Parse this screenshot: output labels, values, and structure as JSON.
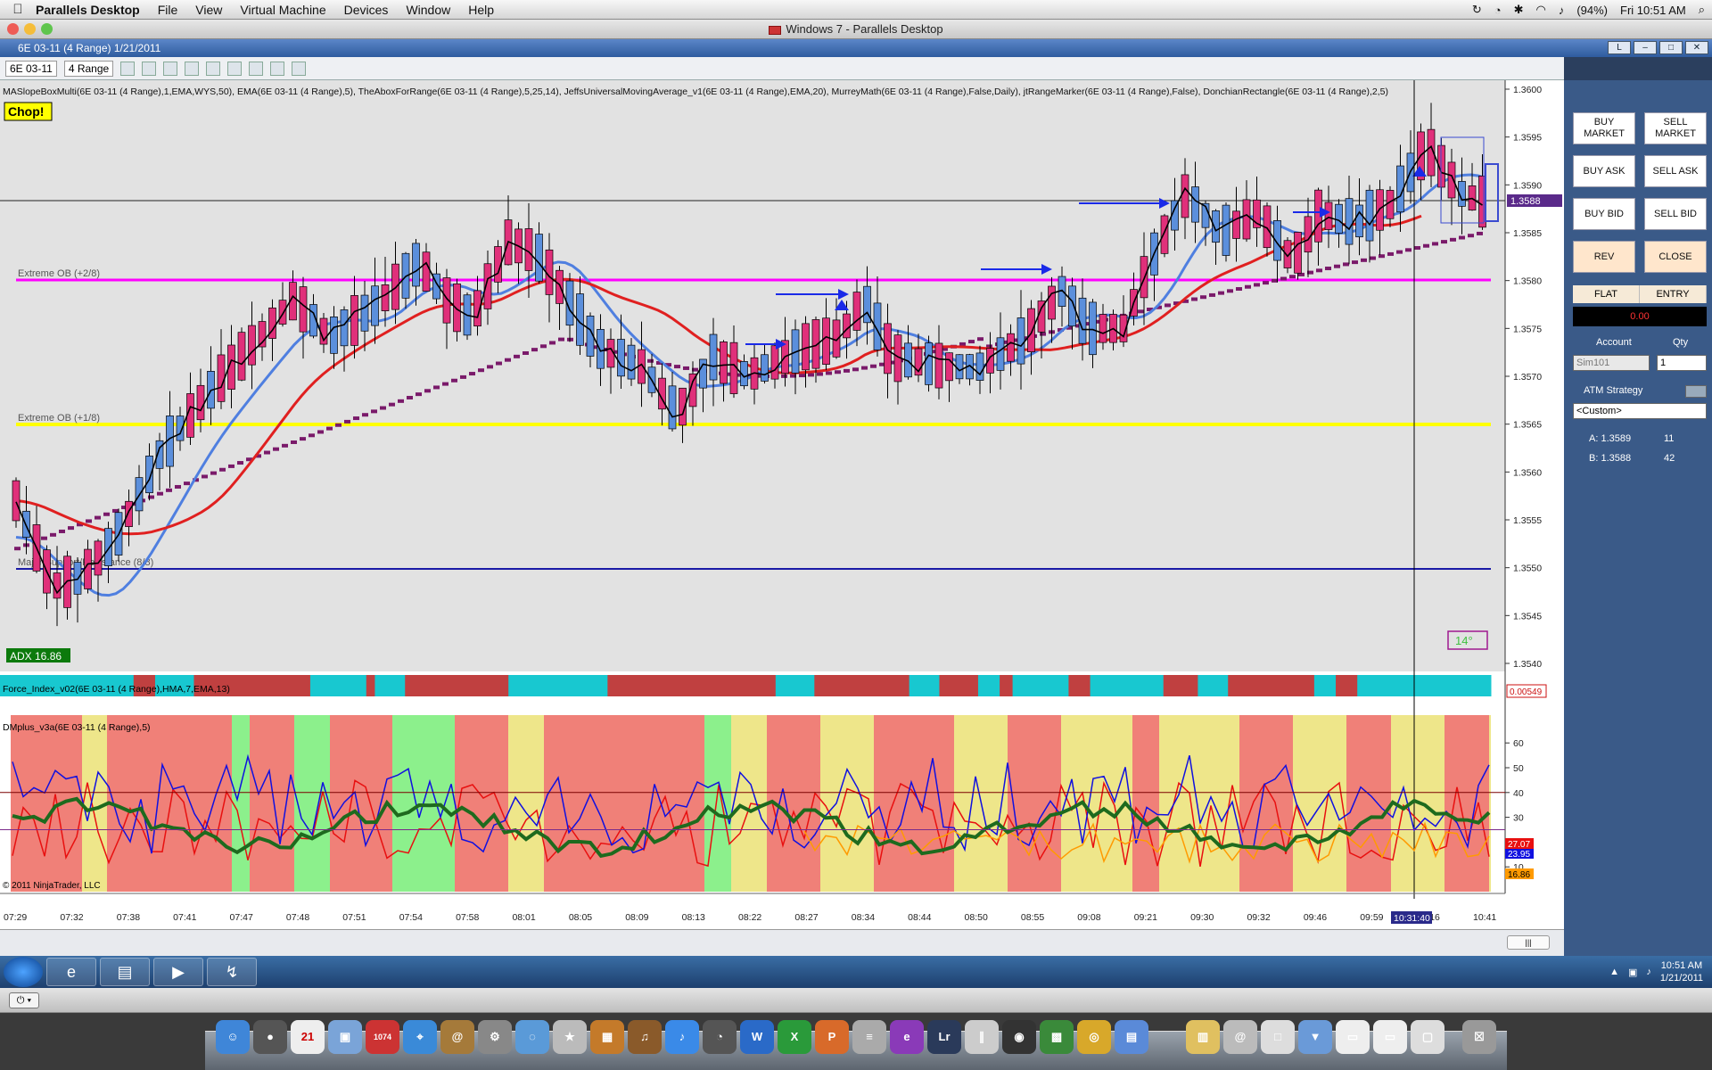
{
  "menubar": {
    "app_name": "Parallels Desktop",
    "items": [
      "File",
      "View",
      "Virtual Machine",
      "Devices",
      "Window",
      "Help"
    ],
    "battery": "(94%)",
    "clock": "Fri 10:51 AM"
  },
  "window": {
    "title": "Windows 7 - Parallels Desktop"
  },
  "chart_window": {
    "caption": "6E 03-11 (4 Range)  1/21/2011",
    "caption_btn_label": "L",
    "instrument": "6E 03-11",
    "period": "4 Range"
  },
  "chart": {
    "indicator_header": "MASlopeBoxMulti(6E 03-11 (4 Range),1,EMA,WYS,50), EMA(6E 03-11 (4 Range),5), TheAboxForRange(6E 03-11 (4 Range),5,25,14), JeffsUniversalMovingAverage_v1(6E 03-11 (4 Range),EMA,20), MurreyMath(6E 03-11 (4 Range),False,Daily), jtRangeMarker(6E 03-11 (4 Range),False), DonchianRectangle(6E 03-11 (4 Range),2,5)",
    "chop_label": "Chop!",
    "adx_label": "ADX 16.86",
    "angle_label": "14°",
    "level_labels": {
      "ob2": "Extreme OB (+2/8)",
      "ob1": "Extreme OB (+1/8)",
      "major": "Major Support/Resistance (8/8)"
    },
    "price_ticks": [
      "1.3600",
      "1.3595",
      "1.3590",
      "1.3585",
      "1.3580",
      "1.3575",
      "1.3570",
      "1.3565",
      "1.3560",
      "1.3555",
      "1.3550",
      "1.3545",
      "1.3540"
    ],
    "current_price": "1.3588",
    "force_label": "Force_Index_v02(6E 03-11 (4 Range),HMA,7,EMA,13)",
    "force_value": "0.00549",
    "dmplus_label": "DMplus_v3a(6E 03-11 (4 Range),5)",
    "dm_ticks": [
      "60",
      "50",
      "40",
      "30",
      "20",
      "10"
    ],
    "dm_values": {
      "red": "27.07",
      "blue": "23.95",
      "orange": "16.86"
    },
    "copyright": "© 2011 NinjaTrader, LLC",
    "time_labels": [
      "07:29",
      "07:32",
      "07:38",
      "07:41",
      "07:47",
      "07:48",
      "07:51",
      "07:54",
      "07:58",
      "08:01",
      "08:05",
      "08:09",
      "08:13",
      "08:22",
      "08:27",
      "08:34",
      "08:44",
      "08:50",
      "08:55",
      "09:08",
      "09:21",
      "09:30",
      "09:32",
      "09:46",
      "09:59",
      "10:16",
      "10:41"
    ],
    "cursor_time": "10:31:40"
  },
  "trade_panel": {
    "buy_market": "BUY MARKET",
    "sell_market": "SELL MARKET",
    "buy_ask": "BUY ASK",
    "sell_ask": "SELL ASK",
    "buy_bid": "BUY BID",
    "sell_bid": "SELL BID",
    "rev": "REV",
    "close": "CLOSE",
    "flat": "FLAT",
    "entry": "ENTRY",
    "pnl": "0.00",
    "account_label": "Account",
    "qty_label": "Qty",
    "account_value": "Sim101",
    "qty_value": "1",
    "atm_label": "ATM Strategy",
    "atm_value": "<Custom>",
    "ask_label": "A: 1.3589",
    "ask_size": "11",
    "bid_label": "B: 1.3588",
    "bid_size": "42"
  },
  "taskbar": {
    "time": "10:51 AM",
    "date": "1/21/2011"
  },
  "dock": {
    "lr_label": "Lr",
    "badge": "1074"
  }
}
